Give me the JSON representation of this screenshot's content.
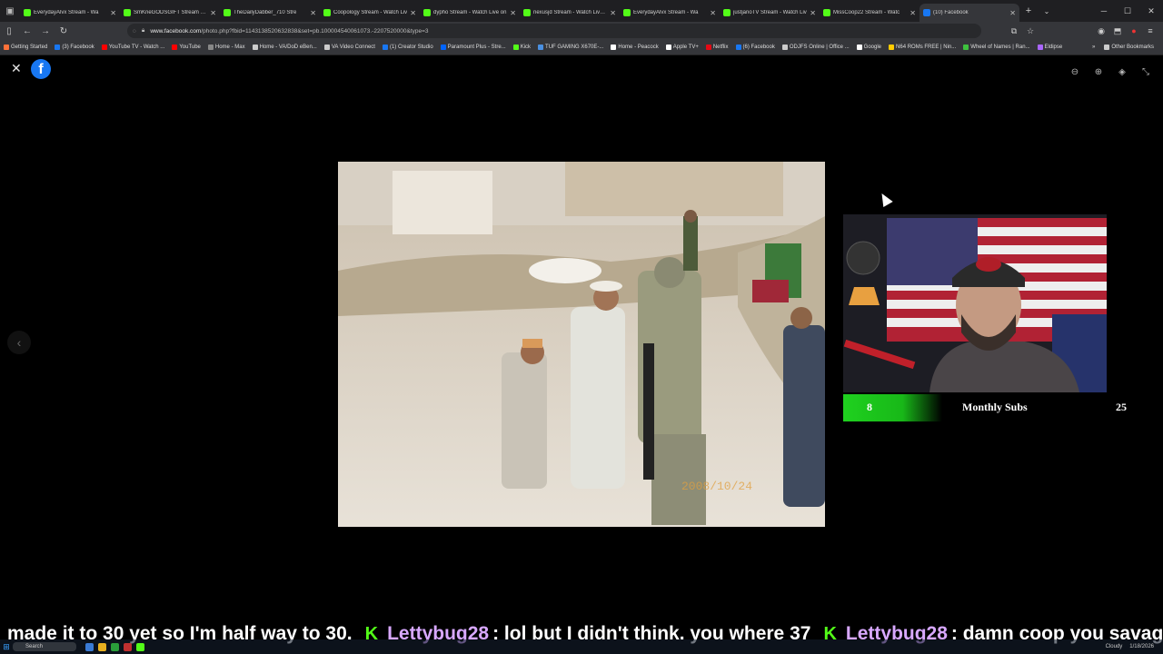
{
  "browser": {
    "tabs": [
      {
        "title": "EverydayAlvx Stream - Wa",
        "color": "#53fc18"
      },
      {
        "title": "SmKneGODSGIFT Stream - Wa",
        "color": "#53fc18"
      },
      {
        "title": "TheDailyDabber_710 Stre",
        "color": "#53fc18"
      },
      {
        "title": "Coopology Stream - Watch Liv",
        "color": "#53fc18"
      },
      {
        "title": "dypho Stream - Watch Live on",
        "color": "#53fc18"
      },
      {
        "title": "nexusjd Stream - Watch Live o",
        "color": "#53fc18"
      },
      {
        "title": "EverydayAlvx Stream - Wa",
        "color": "#53fc18"
      },
      {
        "title": "justjanoTV Stream - Watch Liv",
        "color": "#53fc18"
      },
      {
        "title": "MissCoop22 Stream - Watc",
        "color": "#53fc18"
      },
      {
        "title": "(10) Facebook",
        "color": "#1877f2",
        "active": true
      }
    ],
    "url_domain": "www.facebook.com",
    "url_path": "/photo.php?fbid=1143138520632838&set=pb.100004540061073.-2207520000&type=3",
    "bookmarks": [
      {
        "label": "Getting Started",
        "color": "#ff7139"
      },
      {
        "label": "(3) Facebook",
        "color": "#1877f2"
      },
      {
        "label": "YouTube TV - Watch ...",
        "color": "#ff0000"
      },
      {
        "label": "YouTube",
        "color": "#ff0000"
      },
      {
        "label": "Home - Max",
        "color": "#888888"
      },
      {
        "label": "Home - VA/DoD eBen...",
        "color": "#cccccc"
      },
      {
        "label": "VA Video Connect",
        "color": "#cccccc"
      },
      {
        "label": "(1) Creator Studio",
        "color": "#1877f2"
      },
      {
        "label": "Paramount Plus - Stre...",
        "color": "#0064ff"
      },
      {
        "label": "Kick",
        "color": "#53fc18"
      },
      {
        "label": "TUF GAMING X670E-...",
        "color": "#4a90e2"
      },
      {
        "label": "Home - Peacock",
        "color": "#ffffff"
      },
      {
        "label": "Apple TV+",
        "color": "#ffffff"
      },
      {
        "label": "Netflix",
        "color": "#e50914"
      },
      {
        "label": "(6) Facebook",
        "color": "#1877f2"
      },
      {
        "label": "ODJFS Online | Office ...",
        "color": "#cccccc"
      },
      {
        "label": "Google",
        "color": "#ffffff"
      },
      {
        "label": "N64 ROMs FREE | Nin...",
        "color": "#ffcc00"
      },
      {
        "label": "Wheel of Names | Ran...",
        "color": "#3ec13e"
      },
      {
        "label": "Eldipse",
        "color": "#aa66ff"
      }
    ],
    "other_bookmarks": "Other Bookmarks"
  },
  "viewer": {
    "logo_letter": "f"
  },
  "photo": {
    "date_stamp": "2008/10/24"
  },
  "overlay": {
    "subs_current": "8",
    "subs_label": "Monthly Subs",
    "subs_goal": "25",
    "progress_fraction": 0.32
  },
  "ticker": {
    "lead_text": "made it to 30 yet so I'm half way to 30.",
    "messages": [
      {
        "user": "Lettybug28",
        "text": ": lol but I didn't think. you where 37"
      },
      {
        "user": "Lettybug28",
        "text": ": damn coop you savage"
      }
    ]
  },
  "taskbar": {
    "search_label": "Search",
    "weather": "Cloudy",
    "date": "1/18/2026"
  }
}
